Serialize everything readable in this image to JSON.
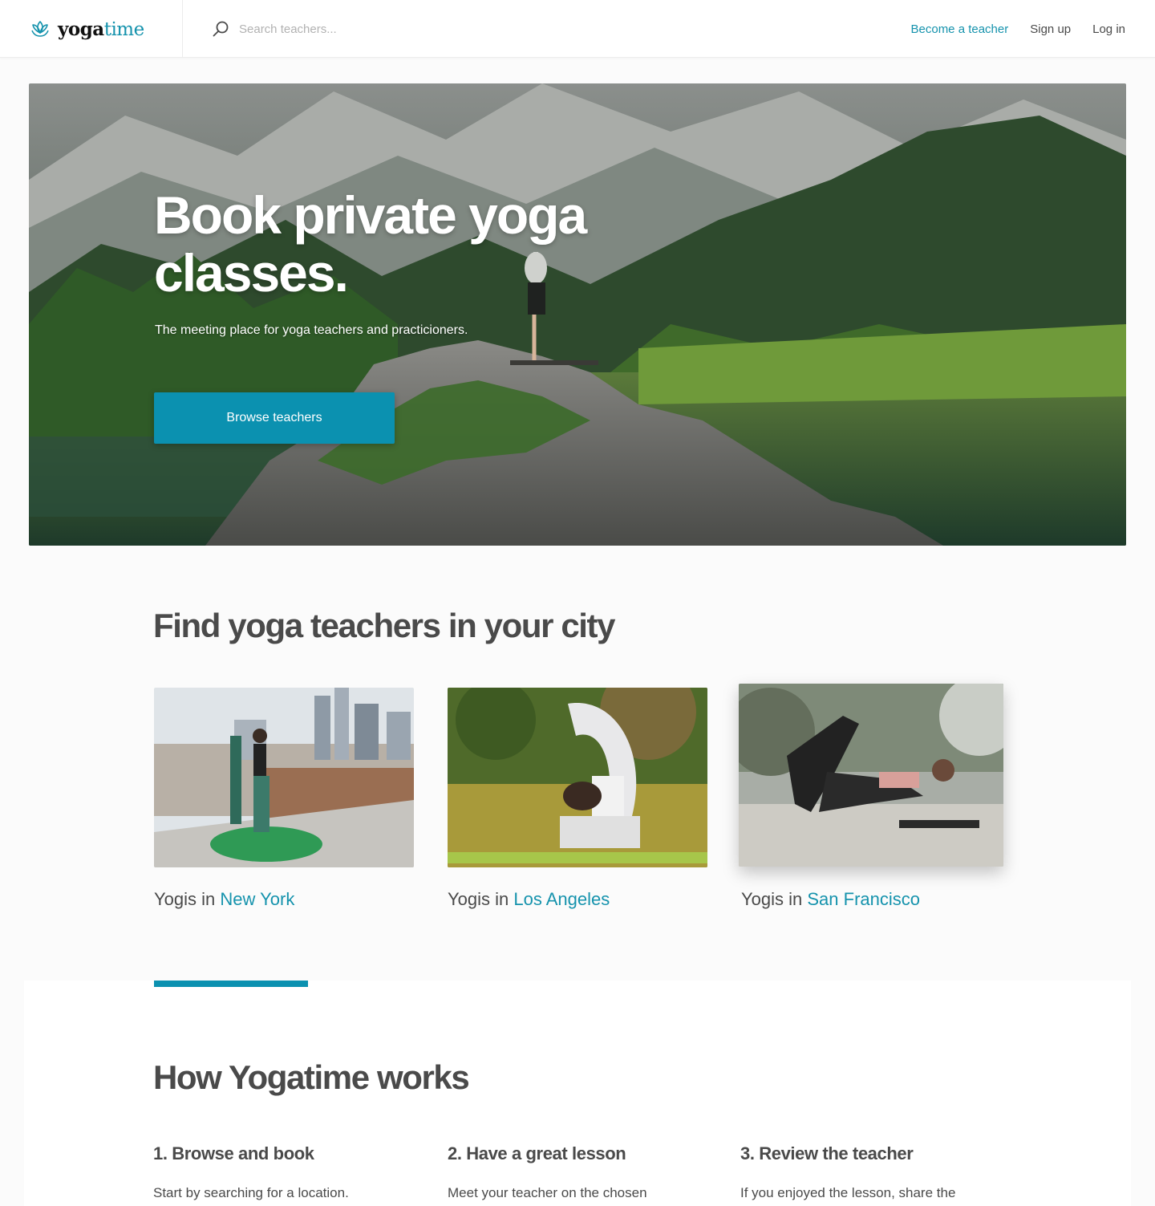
{
  "brand": {
    "part1": "yoga",
    "part2": "time",
    "accent_color": "#1693ad"
  },
  "header": {
    "search_placeholder": "Search teachers...",
    "nav": {
      "become_teacher": "Become a teacher",
      "sign_up": "Sign up",
      "log_in": "Log in"
    }
  },
  "hero": {
    "title": "Book private yoga classes.",
    "subtitle": "The meeting place for yoga teachers and practicioners.",
    "cta": "Browse teachers",
    "button_color": "#0b91b0"
  },
  "cities": {
    "title": "Find yoga teachers in your city",
    "prefix": "Yogis in",
    "items": [
      {
        "name": "New York"
      },
      {
        "name": "Los Angeles"
      },
      {
        "name": "San Francisco"
      }
    ]
  },
  "how": {
    "title": "How Yogatime works",
    "steps": [
      {
        "title": "1. Browse and book",
        "text": "Start by searching for a location."
      },
      {
        "title": "2. Have a great lesson",
        "text": "Meet your teacher on the chosen"
      },
      {
        "title": "3. Review the teacher",
        "text": "If you enjoyed the lesson, share the"
      }
    ]
  },
  "icons": {
    "logo": "lotus-icon",
    "search": "search-icon"
  }
}
